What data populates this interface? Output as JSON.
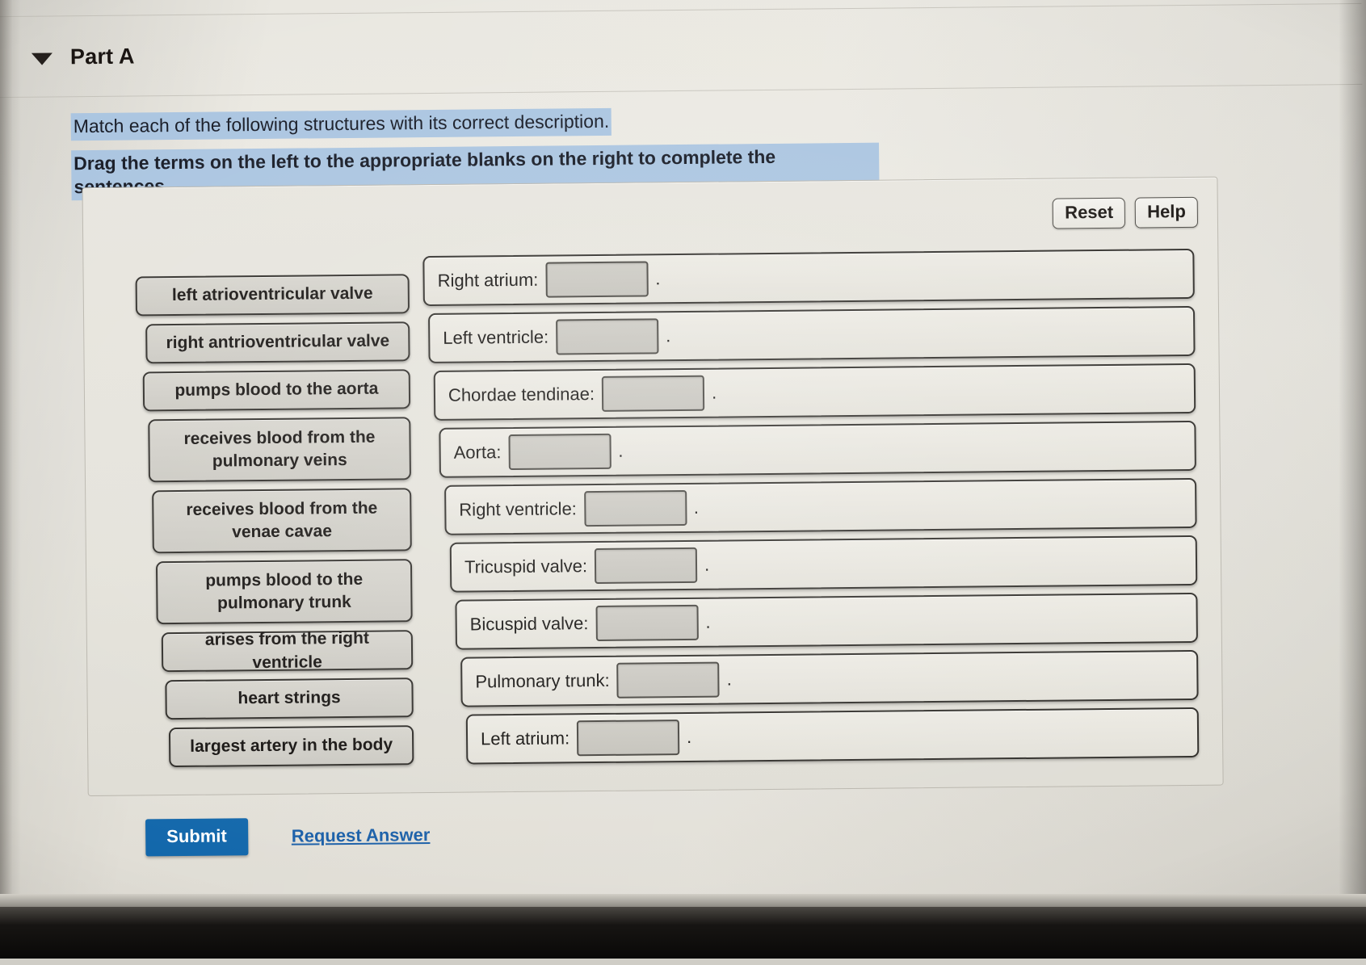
{
  "header": {
    "part_label": "Part A",
    "collapse_icon": "caret-down-icon"
  },
  "instructions": {
    "line1": "Match each of the following structures with its correct description.",
    "line2": "Drag the terms on the left to the appropriate blanks on the right to complete the sentences.",
    "highlight_color": "#a9c4e0"
  },
  "panel": {
    "reset_label": "Reset",
    "help_label": "Help"
  },
  "bank": {
    "tiles": [
      {
        "label": "left atrioventricular valve",
        "lines": 1
      },
      {
        "label": "right antrioventricular valve",
        "lines": 1
      },
      {
        "label": "pumps blood to the aorta",
        "lines": 1
      },
      {
        "label": "receives blood from the pulmonary veins",
        "lines": 2
      },
      {
        "label": "receives blood from the venae cavae",
        "lines": 2
      },
      {
        "label": "pumps blood to the pulmonary trunk",
        "lines": 2
      },
      {
        "label": "arises from the right ventricle",
        "lines": 1
      },
      {
        "label": "heart strings",
        "lines": 1
      },
      {
        "label": "largest artery in the body",
        "lines": 1
      }
    ]
  },
  "rows": [
    {
      "label": "Right atrium:",
      "value": "",
      "terminator": "."
    },
    {
      "label": "Left ventricle:",
      "value": "",
      "terminator": "."
    },
    {
      "label": "Chordae tendinae:",
      "value": "",
      "terminator": "."
    },
    {
      "label": "Aorta:",
      "value": "",
      "terminator": "."
    },
    {
      "label": "Right ventricle:",
      "value": "",
      "terminator": "."
    },
    {
      "label": "Tricuspid valve:",
      "value": "",
      "terminator": "."
    },
    {
      "label": "Bicuspid valve:",
      "value": "",
      "terminator": "."
    },
    {
      "label": "Pulmonary trunk:",
      "value": "",
      "terminator": "."
    },
    {
      "label": "Left atrium:",
      "value": "",
      "terminator": "."
    }
  ],
  "footer": {
    "submit_label": "Submit",
    "request_answer_label": "Request Answer",
    "submit_color": "#1267ab",
    "link_color": "#1a5fa8"
  }
}
